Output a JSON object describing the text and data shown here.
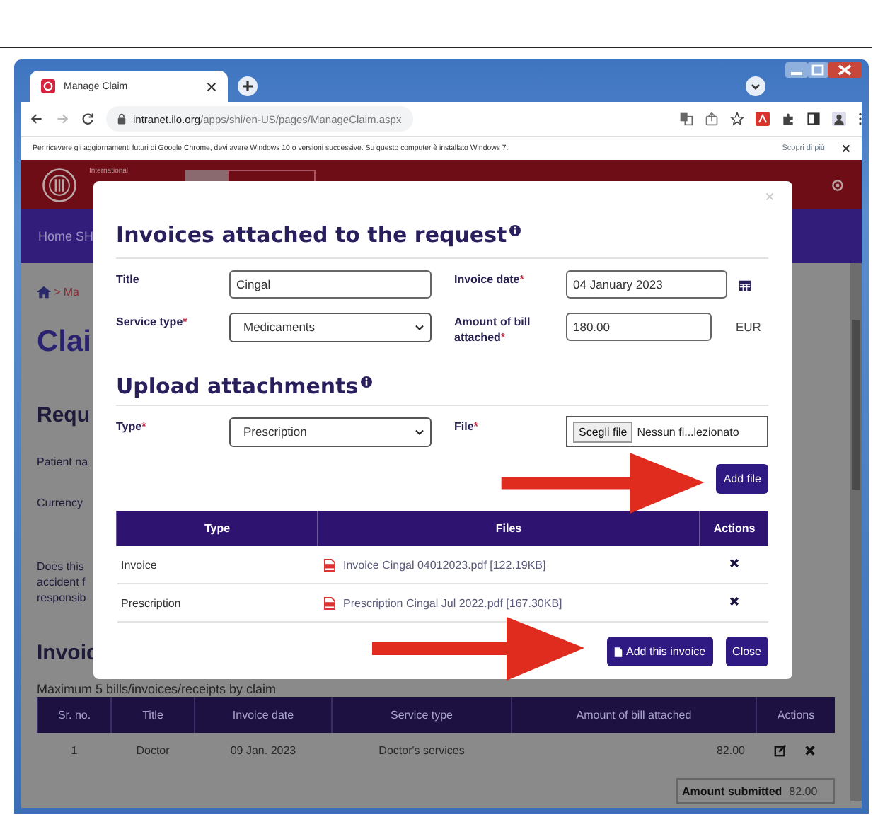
{
  "browser": {
    "tab": {
      "title": "Manage Claim",
      "selected": true
    },
    "url": {
      "host": "intranet.ilo.org",
      "path": "/apps/shi/en-US/pages/ManageClaim.aspx"
    },
    "infobar": {
      "message": "Per ricevere gli aggiornamenti futuri di Google Chrome, devi avere Windows 10 o versioni successive. Su questo computer è installato Windows 7.",
      "link": "Scopri di più"
    }
  },
  "header": {
    "org_name": "International"
  },
  "nav": {
    "items": [
      "Home SH"
    ]
  },
  "page": {
    "breadcrumb": "> Ma",
    "title": "Clai",
    "section_heading": "Requ",
    "field_labels": [
      "Patient na",
      "Currency"
    ],
    "question_lines": [
      "Does this",
      "accident f",
      "responsib"
    ],
    "invoices_heading": "Invoic",
    "invoices_note": "Maximum 5 bills/invoices/receipts by claim",
    "invoices_table": {
      "columns": [
        "Sr. no.",
        "Title",
        "Invoice date",
        "Service type",
        "Amount of bill attached",
        "Actions"
      ],
      "rows": [
        {
          "sr_no": "1",
          "title": "Doctor",
          "invoice_date": "09 Jan. 2023",
          "service_type": "Doctor's services",
          "amount": "82.00"
        }
      ]
    },
    "amount_submitted": {
      "label": "Amount submitted",
      "value": "82.00"
    }
  },
  "modal": {
    "title": "Invoices attached to the request",
    "fields": [
      {
        "kind": "text",
        "label": "Title",
        "value": "Cingal"
      },
      {
        "kind": "date",
        "label": "Invoice date",
        "mark": "*",
        "value": "04 January 2023"
      },
      {
        "kind": "select",
        "label": "Service type",
        "mark": "*",
        "value": "Medicaments"
      },
      {
        "kind": "amount",
        "label": "Amount of bill attached",
        "mark": "*",
        "value": "180.00",
        "unit": "EUR"
      }
    ],
    "upload": {
      "heading": "Upload attachments",
      "type": {
        "label": "Type",
        "mark": "*",
        "value": "Prescription"
      },
      "file": {
        "label": "File",
        "mark": "*",
        "button": "Scegli file",
        "status": "Nessun fi...lezionato"
      },
      "add_button": "Add file",
      "table": {
        "columns": [
          "Type",
          "Files",
          "Actions"
        ],
        "rows": [
          {
            "type": "Invoice",
            "file": "Invoice Cingal 04012023.pdf [122.19KB]"
          },
          {
            "type": "Prescription",
            "file": "Prescription Cingal Jul 2022.pdf [167.30KB]"
          }
        ]
      }
    },
    "buttons": [
      {
        "kind": "primary",
        "label": "Add this invoice"
      },
      {
        "kind": "close",
        "label": "Close"
      }
    ]
  }
}
